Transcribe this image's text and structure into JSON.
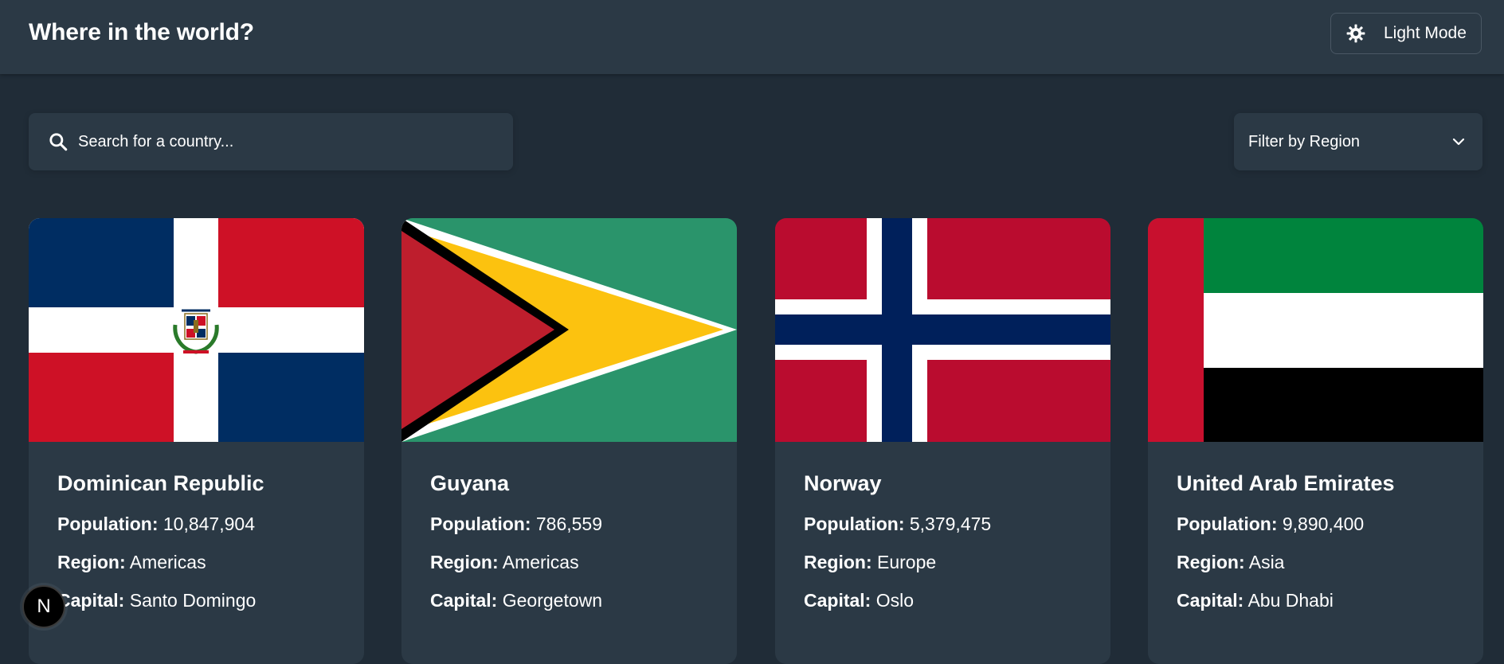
{
  "header": {
    "title": "Where in the world?",
    "theme_toggle_label": "Light Mode"
  },
  "search": {
    "placeholder": "Search for a country..."
  },
  "filter": {
    "label": "Filter by Region"
  },
  "labels": {
    "population": "Population:",
    "region": "Region:",
    "capital": "Capital:"
  },
  "countries": [
    {
      "name": "Dominican Republic",
      "population": "10,847,904",
      "region": "Americas",
      "capital": "Santo Domingo"
    },
    {
      "name": "Guyana",
      "population": "786,559",
      "region": "Americas",
      "capital": "Georgetown"
    },
    {
      "name": "Norway",
      "population": "5,379,475",
      "region": "Europe",
      "capital": "Oslo"
    },
    {
      "name": "United Arab Emirates",
      "population": "9,890,400",
      "region": "Asia",
      "capital": "Abu Dhabi"
    }
  ],
  "badge": {
    "letter": "N"
  },
  "colors": {
    "background": "#202c37",
    "element": "#2b3945",
    "text": "#ffffff"
  },
  "icons": {
    "theme": "sun-icon",
    "search": "search-icon",
    "filter": "chevron-down-icon"
  }
}
